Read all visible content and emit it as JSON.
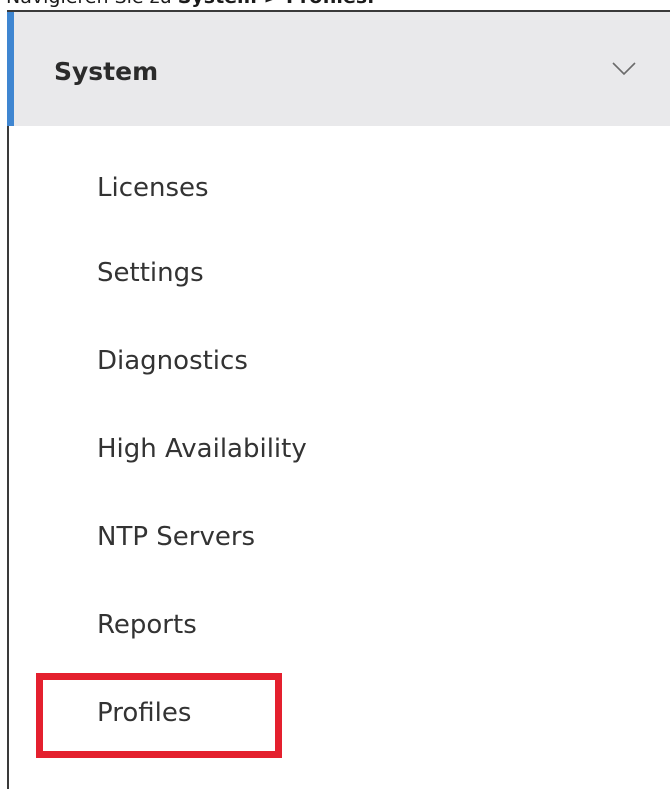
{
  "caption": {
    "prefix": "Navigieren Sie zu ",
    "bold": "System > Profiles."
  },
  "menu": {
    "section_title": "System",
    "chevron_icon": "chevron-down-icon",
    "accent_color": "#3f86d1",
    "items": [
      {
        "label": "Licenses"
      },
      {
        "label": "Settings"
      },
      {
        "label": "Diagnostics"
      },
      {
        "label": "High Availability"
      },
      {
        "label": "NTP Servers"
      },
      {
        "label": "Reports"
      },
      {
        "label": "Profiles"
      }
    ]
  },
  "highlight": {
    "target": "Profiles",
    "color": "#e4202e"
  }
}
